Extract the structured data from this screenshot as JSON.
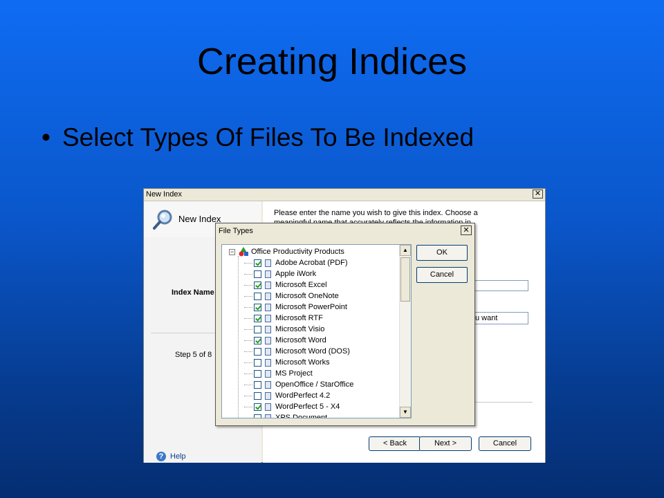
{
  "slide": {
    "title": "Creating Indices",
    "bullet": "Select Types Of Files To Be Indexed",
    "bullet_marker": "•"
  },
  "wizard": {
    "window_title": "New Index",
    "close_glyph": "✕",
    "header_title": "New Index",
    "header_icon": "magnifier-icon",
    "description": "Please enter the name you wish to give this index. Choose a meaningful name that accurately reflects the information in the",
    "index_name_label": "Index Name",
    "step_text": "Step 5 of 8",
    "input1_value": "",
    "input2_value": "u want",
    "help_label": "Help",
    "help_glyph": "?",
    "back_label": "< Back",
    "next_label": "Next >",
    "cancel_label": "Cancel"
  },
  "file_types": {
    "title": "File Types",
    "close_glyph": "✕",
    "ok_label": "OK",
    "cancel_label": "Cancel",
    "root_label": "Office Productivity Products",
    "root_expander": "−",
    "items": [
      {
        "label": "Adobe Acrobat (PDF)",
        "checked": true
      },
      {
        "label": "Apple iWork",
        "checked": false
      },
      {
        "label": "Microsoft Excel",
        "checked": true
      },
      {
        "label": "Microsoft OneNote",
        "checked": false
      },
      {
        "label": "Microsoft PowerPoint",
        "checked": true
      },
      {
        "label": "Microsoft RTF",
        "checked": true
      },
      {
        "label": "Microsoft Visio",
        "checked": false
      },
      {
        "label": "Microsoft Word",
        "checked": true
      },
      {
        "label": "Microsoft Word (DOS)",
        "checked": false
      },
      {
        "label": "Microsoft Works",
        "checked": false
      },
      {
        "label": "MS Project",
        "checked": false
      },
      {
        "label": "OpenOffice / StarOffice",
        "checked": false
      },
      {
        "label": "WordPerfect 4.2",
        "checked": false
      },
      {
        "label": "WordPerfect 5 - X4",
        "checked": true
      },
      {
        "label": "XPS Document",
        "checked": false
      }
    ],
    "scroll_up_glyph": "▲",
    "scroll_down_glyph": "▼"
  },
  "colors": {
    "background_top": "#0f6cf2",
    "background_bottom": "#052e72",
    "dialog_face": "#ece9d8",
    "check_green": "#21a121"
  }
}
